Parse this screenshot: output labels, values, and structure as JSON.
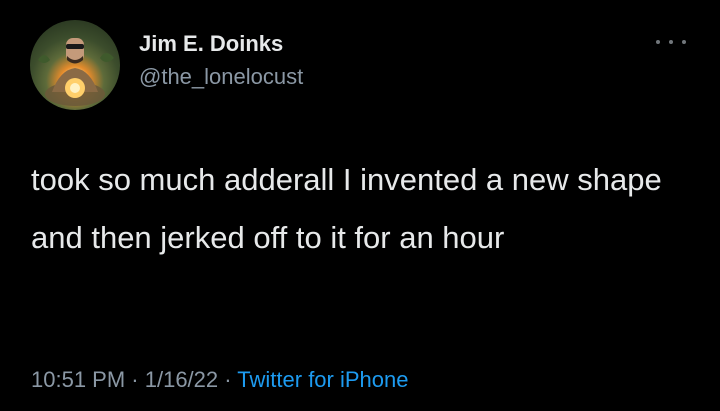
{
  "author": {
    "display_name": "Jim E. Doinks",
    "handle": "@the_lonelocust"
  },
  "tweet": {
    "text": "took so much adderall I invented a new shape and then jerked off to it for an hour"
  },
  "meta": {
    "time": "10:51 PM",
    "separator": " · ",
    "date": "1/16/22",
    "source": "Twitter for iPhone"
  },
  "icons": {
    "more": "ellipsis-horizontal-icon",
    "avatar": "profile-avatar"
  },
  "colors": {
    "background": "#000000",
    "primary_text": "#e7e9ea",
    "secondary_text": "#8b98a5",
    "link": "#1d9bf0"
  }
}
